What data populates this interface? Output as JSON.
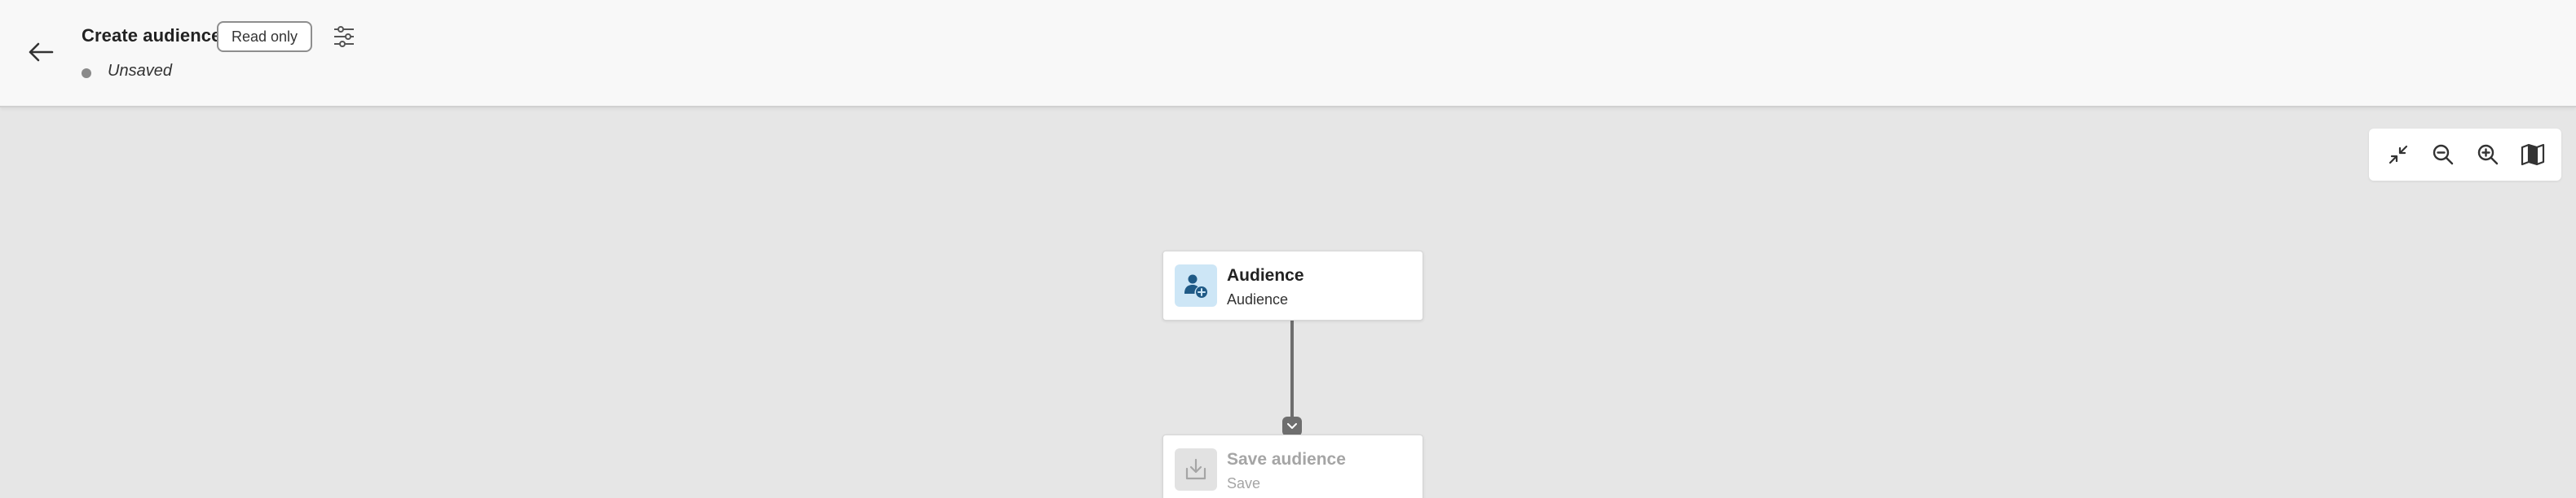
{
  "header": {
    "title": "Create audience",
    "badge": "Read only",
    "status": "Unsaved",
    "back_icon": "arrow-left-icon",
    "settings_icon": "sliders-icon"
  },
  "toolbar": {
    "tools": [
      {
        "name": "fit-to-screen",
        "icon": "collapse-icon"
      },
      {
        "name": "zoom-out",
        "icon": "zoom-out-icon"
      },
      {
        "name": "zoom-in",
        "icon": "zoom-in-icon"
      },
      {
        "name": "minimap",
        "icon": "map-icon"
      }
    ]
  },
  "canvas": {
    "nodes": [
      {
        "title": "Audience",
        "subtitle": "Audience",
        "icon": "audience-add-icon",
        "state": "active"
      },
      {
        "title": "Save audience",
        "subtitle": "Save",
        "icon": "save-download-icon",
        "state": "disabled"
      }
    ]
  },
  "colors": {
    "canvas_bg": "#e6e6e6",
    "header_bg": "#f8f8f8",
    "audience_icon_bg": "#cde6f6",
    "connector": "#6e6e6e"
  }
}
